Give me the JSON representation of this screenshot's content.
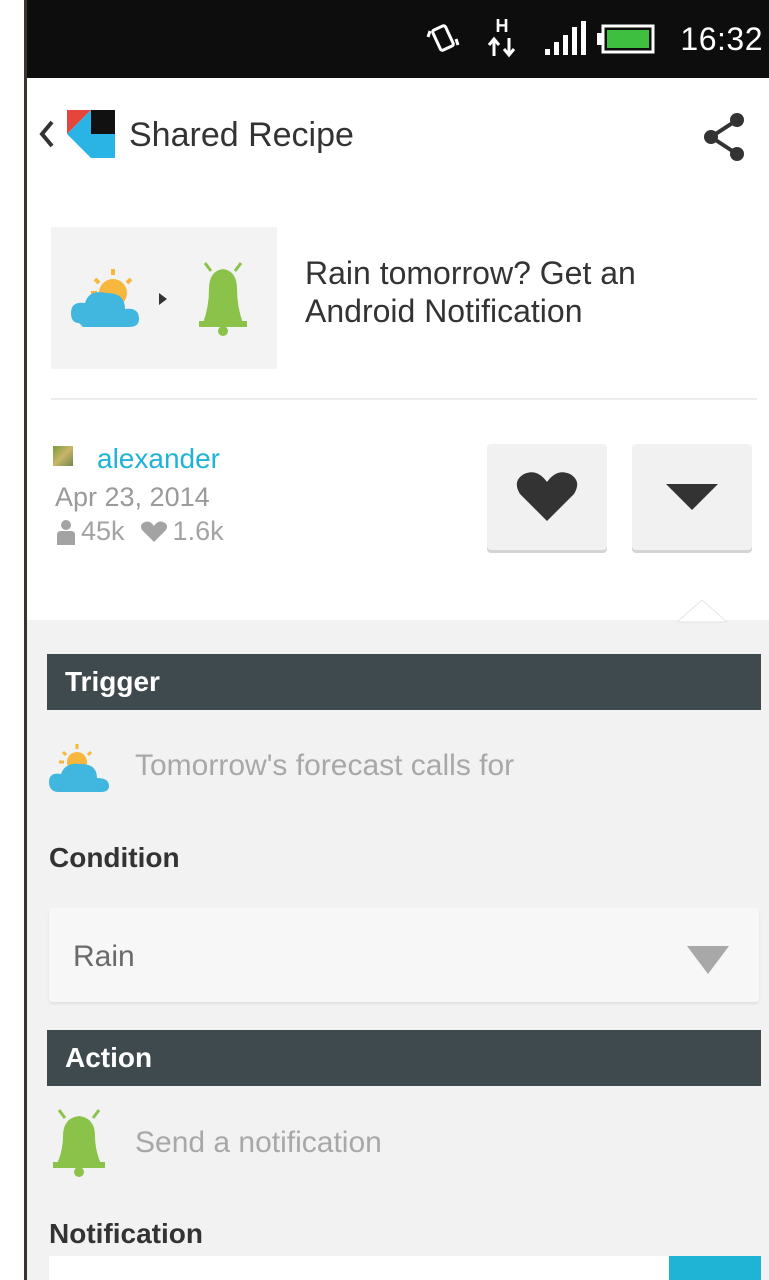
{
  "status_bar": {
    "time": "16:32",
    "network": "H",
    "icons": [
      "vibrate-icon",
      "data-arrows-icon",
      "signal-icon",
      "battery-icon"
    ]
  },
  "header": {
    "title": "Shared Recipe"
  },
  "recipe": {
    "title": "Rain tomorrow? Get an Android Notification",
    "author": "alexander",
    "date": "Apr 23, 2014",
    "users_count": "45k",
    "likes_count": "1.6k"
  },
  "trigger": {
    "section_label": "Trigger",
    "description": "Tomorrow's forecast calls for",
    "condition_label": "Condition",
    "condition_value": "Rain"
  },
  "action": {
    "section_label": "Action",
    "description": "Send a notification",
    "notification_label": "Notification"
  },
  "colors": {
    "accent": "#1fb3d5",
    "section_bar": "#3f4a4f",
    "weather_cloud": "#41b7e0",
    "weather_sun": "#f6b73c",
    "android_green": "#8bc34a"
  }
}
